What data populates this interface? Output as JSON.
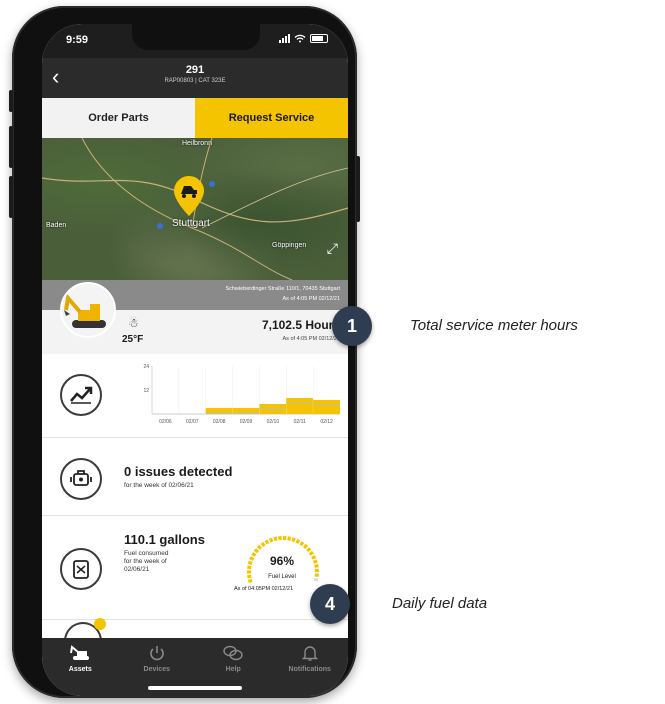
{
  "status_bar": {
    "time": "9:59"
  },
  "header": {
    "asset_number": "291",
    "asset_subtitle": "RAP00803 | CAT 323E",
    "back_icon": "chevron-left-icon"
  },
  "actions": {
    "order_parts": "Order Parts",
    "request_service": "Request Service"
  },
  "map": {
    "city": "Stuttgart",
    "labels": [
      "Heilbronn",
      "Baden",
      "Göppingen"
    ],
    "address": "Schwieberdinger Straße 110/1, 70435 Stuttgart",
    "address_as_of": "As of 4:05 PM 02/12/21"
  },
  "meter": {
    "temperature": "25°F",
    "hours": "7,102.5 Hours",
    "hours_as_of": "As of 4:05 PM 02/12/21"
  },
  "usage_chart": {
    "chart_data": {
      "type": "bar",
      "categories": [
        "02/06",
        "02/07",
        "02/08",
        "02/09",
        "02/10",
        "02/11",
        "02/12"
      ],
      "values": [
        0,
        0,
        3,
        3,
        5,
        8,
        7
      ],
      "ylim": [
        0,
        24
      ],
      "yticks": [
        "24",
        "12"
      ]
    }
  },
  "issues": {
    "title": "0 issues detected",
    "subtitle": "for the week of 02/06/21"
  },
  "fuel": {
    "title": "110.1 gallons",
    "subtitle_lines": [
      "Fuel consumed",
      "for the week of",
      "02/06/21"
    ],
    "level_percent": "96%",
    "level_fraction": 0.96,
    "level_label": "Fuel Level",
    "level_as_of": "As of 04:05PM 02/12/21"
  },
  "bottom_nav": {
    "items": [
      {
        "label": "Assets",
        "icon": "excavator-icon",
        "active": true
      },
      {
        "label": "Devices",
        "icon": "power-icon",
        "active": false
      },
      {
        "label": "Help",
        "icon": "chat-bubbles-icon",
        "active": false
      },
      {
        "label": "Notifications",
        "icon": "bell-icon",
        "active": false
      }
    ]
  },
  "annotations": [
    {
      "number": "1",
      "text": "Total service meter hours"
    },
    {
      "number": "4",
      "text": "Daily fuel data"
    }
  ],
  "colors": {
    "accent": "#f5c400",
    "dark": "#2b2b2b",
    "callout": "#2e3d4f"
  }
}
